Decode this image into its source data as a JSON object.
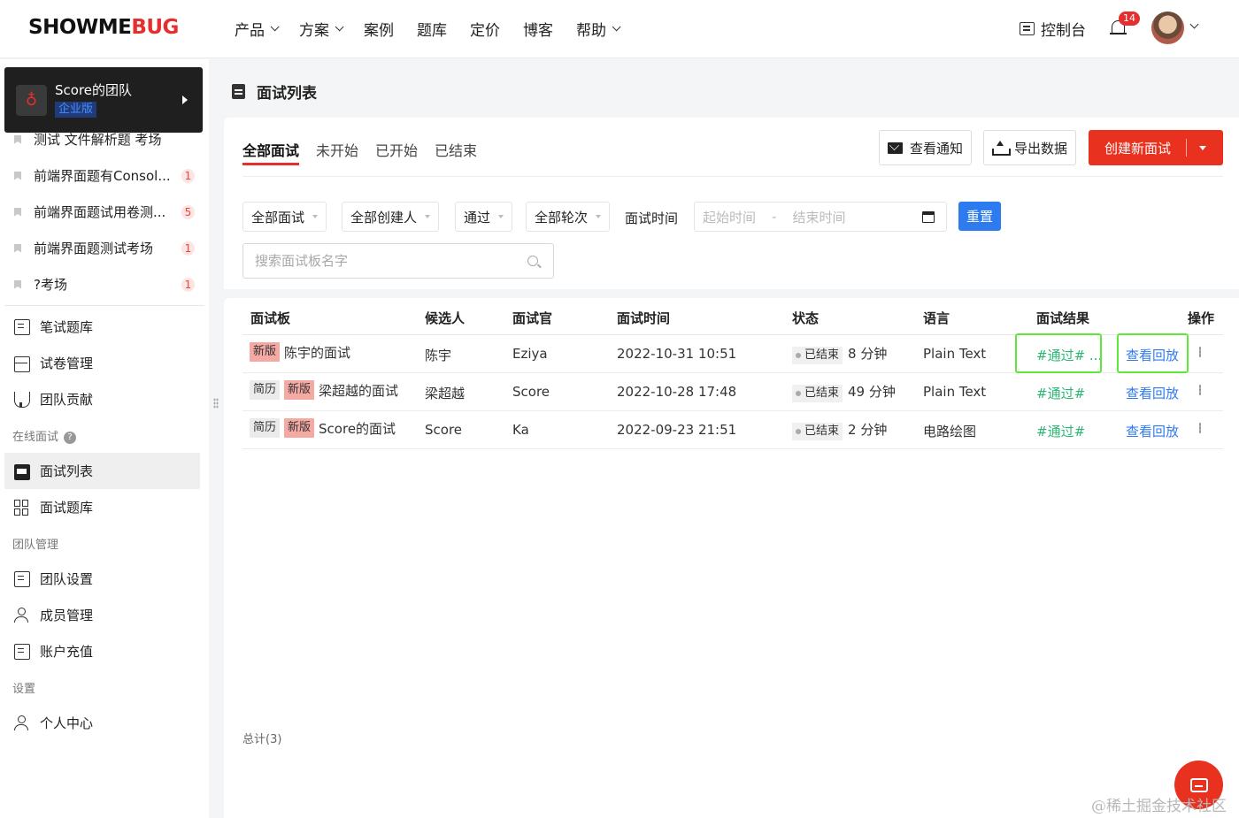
{
  "brand": {
    "logo_prefix": "SHOWME",
    "logo_suffix": "BUG"
  },
  "topnav": {
    "items": [
      {
        "label": "产品",
        "dropdown": true
      },
      {
        "label": "方案",
        "dropdown": true
      },
      {
        "label": "案例",
        "dropdown": false
      },
      {
        "label": "题库",
        "dropdown": false
      },
      {
        "label": "定价",
        "dropdown": false
      },
      {
        "label": "博客",
        "dropdown": false
      },
      {
        "label": "帮助",
        "dropdown": true
      }
    ],
    "console_label": "控制台",
    "notification_count": "14"
  },
  "sidebar": {
    "team": {
      "name": "Score的团队",
      "tier": "企业版",
      "logo_glyph": "♁"
    },
    "exams": [
      {
        "label": "测试 文件解析题 考场",
        "count": ""
      },
      {
        "label": "前端界面题有Consol...",
        "count": "1"
      },
      {
        "label": "前端界面题试用卷测...",
        "count": "5"
      },
      {
        "label": "前端界面题测试考场",
        "count": "1"
      },
      {
        "label": "?考场",
        "count": "1"
      }
    ],
    "group1": {
      "bank": "笔试题库",
      "papers": "试卷管理",
      "contrib": "团队贡献"
    },
    "online_section": "在线面试",
    "online": {
      "list": "面试列表",
      "bank": "面试题库"
    },
    "team_section": "团队管理",
    "team_mgmt": {
      "settings": "团队设置",
      "members": "成员管理",
      "recharge": "账户充值"
    },
    "settings_section": "设置",
    "settings": {
      "profile": "个人中心"
    }
  },
  "page": {
    "title": "面试列表"
  },
  "tabs": [
    "全部面试",
    "未开始",
    "已开始",
    "已结束"
  ],
  "toolbar": {
    "notify": "查看通知",
    "export": "导出数据",
    "create": "创建新面试"
  },
  "filters": {
    "all_interviews": "全部面试",
    "all_creators": "全部创建人",
    "pass": "通过",
    "all_rounds": "全部轮次",
    "time_label": "面试时间",
    "start_placeholder": "起始时间",
    "range_sep": "-",
    "end_placeholder": "结束时间",
    "reset": "重置",
    "search_placeholder": "搜索面试板名字"
  },
  "table": {
    "headers": [
      "面试板",
      "候选人",
      "面试官",
      "面试时间",
      "状态",
      "语言",
      "面试结果",
      "操作"
    ],
    "rows": [
      {
        "tags": [
          "新版"
        ],
        "board": "陈宇的面试",
        "candidate": "陈宇",
        "interviewer": "Eziya",
        "time": "2022-10-31 10:51",
        "status": "已结束",
        "duration": "8 分钟",
        "language": "Plain Text",
        "result": "#通过# ...",
        "action": "查看回放"
      },
      {
        "tags": [
          "简历",
          "新版"
        ],
        "board": "梁超越的面试",
        "candidate": "梁超越",
        "interviewer": "Score",
        "time": "2022-10-28 17:48",
        "status": "已结束",
        "duration": "49 分钟",
        "language": "Plain Text",
        "result": "#通过#",
        "action": "查看回放"
      },
      {
        "tags": [
          "简历",
          "新版"
        ],
        "board": "Score的面试",
        "candidate": "Score",
        "interviewer": "Ka",
        "time": "2022-09-23 21:51",
        "status": "已结束",
        "duration": "2 分钟",
        "language": "电路绘图",
        "result": "#通过#",
        "action": "查看回放"
      }
    ],
    "total": "总计(3)"
  },
  "watermark": "@稀土掘金技术社区",
  "colors": {
    "brand_red": "#e8311f",
    "link_blue": "#2e7bf0",
    "result_green": "#2bb673",
    "highlight_green": "#5ee83a"
  }
}
